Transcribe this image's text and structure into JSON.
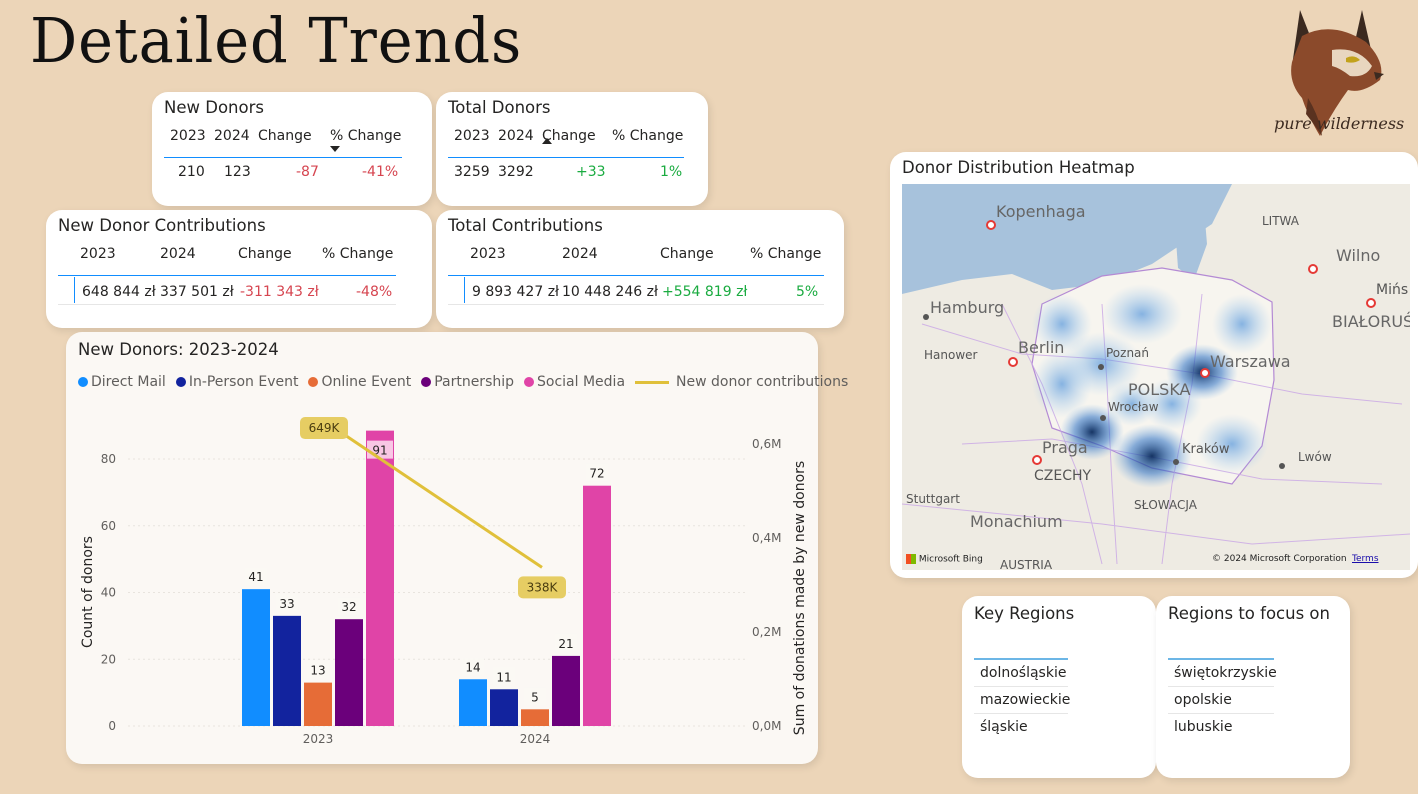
{
  "page": {
    "title": "Detailed Trends"
  },
  "brand": {
    "name": "pure wilderness",
    "colors": {
      "fur": "#8b4a2b",
      "ear": "#3b2a20",
      "eye": "#c2a21b"
    }
  },
  "new_donors": {
    "title": "New Donors",
    "headers": [
      "2023",
      "2024",
      "Change",
      "% Change"
    ],
    "values": {
      "y2023": "210",
      "y2024": "123",
      "change": "-87",
      "pct": "-41%"
    },
    "sort": "descending"
  },
  "total_donors": {
    "title": "Total Donors",
    "headers": [
      "2023",
      "2024",
      "Change",
      "% Change"
    ],
    "values": {
      "y2023": "3259",
      "y2024": "3292",
      "change": "+33",
      "pct": "1%"
    },
    "sort": "ascending"
  },
  "new_donor_contributions": {
    "title": "New Donor Contributions",
    "headers": [
      "2023",
      "2024",
      "Change",
      "% Change"
    ],
    "values": {
      "y2023": "648 844 zł",
      "y2024": "337 501 zł",
      "change": "-311 343 zł",
      "pct": "-48%"
    }
  },
  "total_contributions": {
    "title": "Total Contributions",
    "headers": [
      "2023",
      "2024",
      "Change",
      "% Change"
    ],
    "values": {
      "y2023": "9 893 427 zł",
      "y2024": "10 448 246 zł",
      "change": "+554 819 zł",
      "pct": "5%"
    }
  },
  "colors": {
    "negative": "#d64550",
    "positive": "#1aab40",
    "accent": "#118dff"
  },
  "chart_data": {
    "type": "bar",
    "title": "New Donors: 2023-2024",
    "categories": [
      "2023",
      "2024"
    ],
    "series": [
      {
        "name": "Direct Mail",
        "color": "#118dff",
        "values": [
          41,
          14
        ]
      },
      {
        "name": "In-Person Event",
        "color": "#12239e",
        "values": [
          33,
          11
        ]
      },
      {
        "name": "Online Event",
        "color": "#e66c37",
        "values": [
          13,
          5
        ]
      },
      {
        "name": "Partnership",
        "color": "#6b007b",
        "values": [
          32,
          21
        ]
      },
      {
        "name": "Social Media",
        "color": "#e044a7",
        "values": [
          91,
          72
        ]
      }
    ],
    "line_series": {
      "name": "New donor contributions",
      "color": "#e0c03a",
      "values": [
        648844,
        337501
      ],
      "labels": [
        "649K",
        "338K"
      ]
    },
    "ylabel": "Count of donors",
    "y2label": "Sum of donations made by new donors",
    "yticks": [
      "0",
      "20",
      "40",
      "60",
      "80"
    ],
    "y2ticks": [
      "0,0M",
      "0,2M",
      "0,4M",
      "0,6M"
    ],
    "ylim": [
      0,
      80
    ],
    "y2lim": [
      0,
      0.6
    ],
    "legend_position": "top-left",
    "grid": true
  },
  "heatmap": {
    "title": "Donor Distribution Heatmap",
    "labels": {
      "kopenhaga": "Kopenhaga",
      "litwa": "LITWA",
      "wilno": "Wilno",
      "minsk": "Mińs",
      "bialorus": "BIAŁORUŚ",
      "hamburg": "Hamburg",
      "hanower": "Hanower",
      "berlin": "Berlin",
      "poznan": "Poznań",
      "warszawa": "Warszawa",
      "polska": "POLSKA",
      "wroclaw": "Wrocław",
      "praga": "Praga",
      "czechy": "CZECHY",
      "krakow": "Kraków",
      "lwow": "Lwów",
      "stuttgart": "Stuttgart",
      "monachium": "Monachium",
      "slowacja": "SŁOWACJA",
      "austria": "AUSTRIA"
    },
    "bing": "Microsoft Bing",
    "copyright": "© 2024 Microsoft Corporation",
    "terms": "Terms"
  },
  "key_regions": {
    "title": "Key Regions",
    "items": [
      "dolnośląskie",
      "mazowieckie",
      "śląskie"
    ]
  },
  "focus_regions": {
    "title": "Regions to focus on",
    "items": [
      "świętokrzyskie",
      "opolskie",
      "lubuskie"
    ]
  }
}
